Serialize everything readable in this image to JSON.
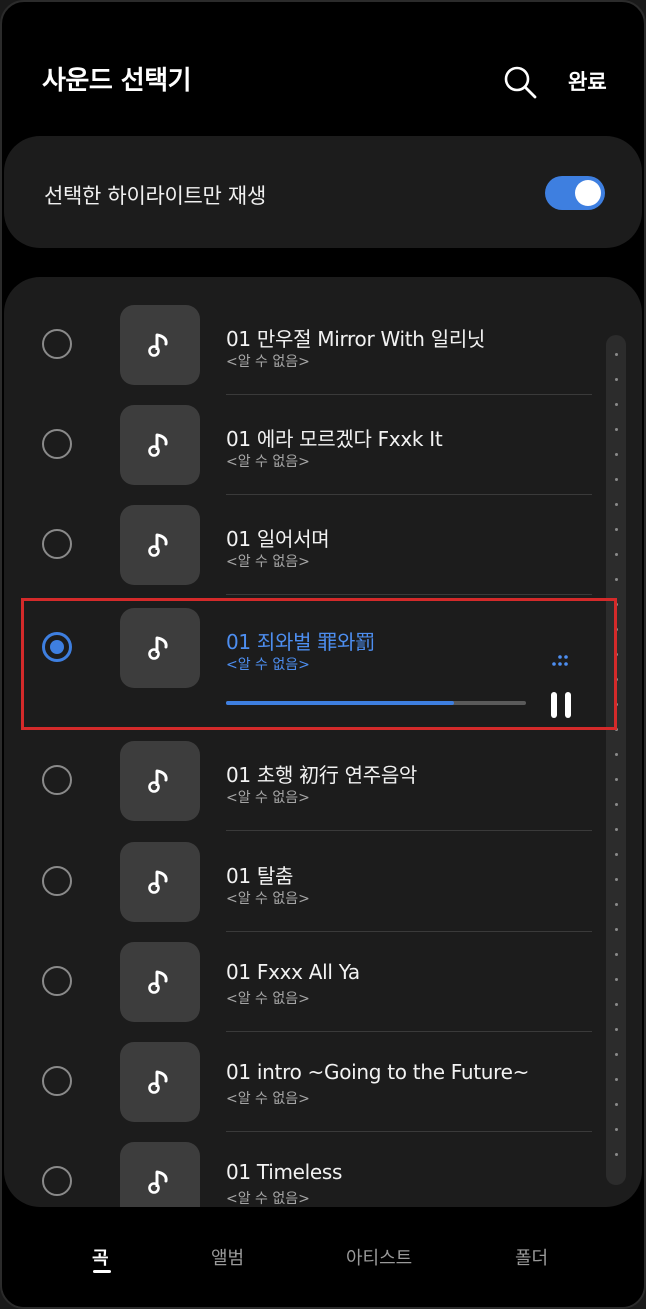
{
  "header": {
    "title": "사운드 선택기",
    "done_label": "완료"
  },
  "highlight": {
    "label": "선택한 하이라이트만 재생",
    "enabled": true
  },
  "songs": [
    {
      "title": "01 만우절 Mirror With 일리닛",
      "artist": "<알 수 없음>",
      "selected": false
    },
    {
      "title": "01 에라 모르겠다 Fxxk It",
      "artist": "<알 수 없음>",
      "selected": false
    },
    {
      "title": "01 일어서며",
      "artist": "<알 수 없음>",
      "selected": false
    },
    {
      "title": "01 죄와벌 罪와罰",
      "artist": "<알 수 없음>",
      "selected": true,
      "progress": 0.76
    },
    {
      "title": "01 초행 初行 연주음악",
      "artist": "<알 수 없음>",
      "selected": false
    },
    {
      "title": "01 탈춤",
      "artist": "<알 수 없음>",
      "selected": false
    },
    {
      "title": "01 Fxxx All Ya",
      "artist": "<알 수 없음>",
      "selected": false
    },
    {
      "title": "01 intro ~Going to the Future~",
      "artist": "<알 수 없음>",
      "selected": false
    },
    {
      "title": "01 Timeless",
      "artist": "<알 수 없음>",
      "selected": false
    }
  ],
  "tabs": [
    {
      "label": "곡",
      "active": true
    },
    {
      "label": "앨범",
      "active": false
    },
    {
      "label": "아티스트",
      "active": false
    },
    {
      "label": "폴더",
      "active": false
    }
  ],
  "colors": {
    "accent": "#3e7fe0",
    "highlight_box": "#d42a2a"
  }
}
